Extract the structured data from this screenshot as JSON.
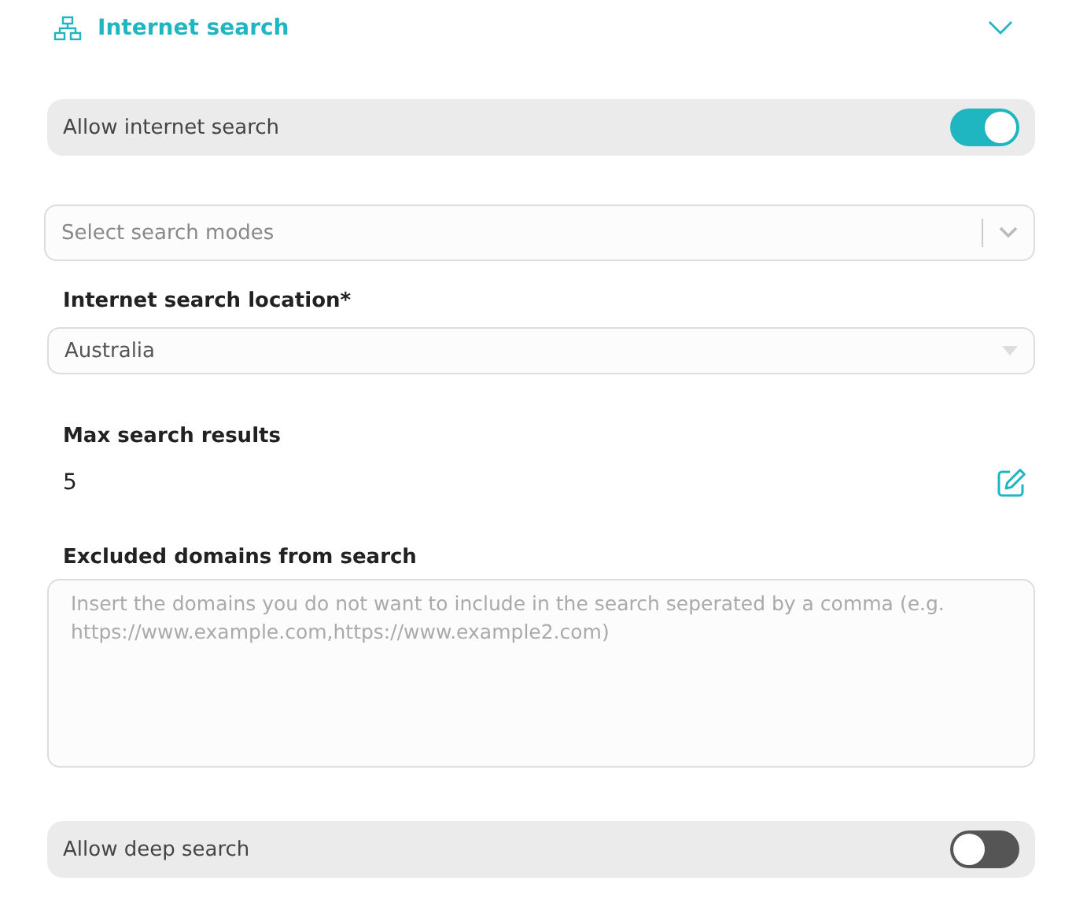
{
  "section": {
    "title": "Internet search",
    "expanded": true
  },
  "allow_internet_search": {
    "label": "Allow internet search",
    "on": true
  },
  "search_modes": {
    "placeholder": "Select search modes"
  },
  "location": {
    "label": "Internet search location*",
    "value": "Australia"
  },
  "max_results": {
    "label": "Max search results",
    "value": "5"
  },
  "excluded_domains": {
    "label": "Excluded domains from search",
    "placeholder": "Insert the domains you do not want to include in the search seperated by a comma (e.g. https://www.example.com,https://www.example2.com)"
  },
  "allow_deep_search": {
    "label": "Allow deep search",
    "on": false
  }
}
